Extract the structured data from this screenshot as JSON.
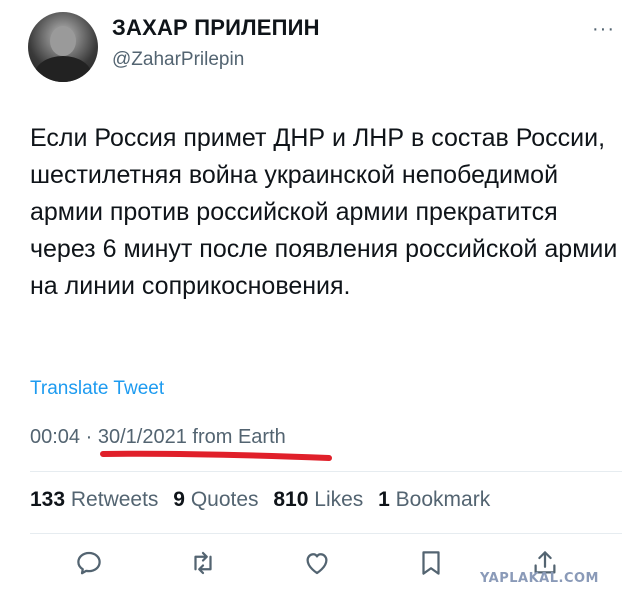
{
  "author": {
    "name": "ЗАХАР ПРИЛЕПИН",
    "handle": "@ZaharPrilepin"
  },
  "tweet": {
    "text": "Если Россия примет ДНР и ЛНР в состав России, шестилетняя война украинской непобедимой армии против российской армии прекратится через 6 минут после появления российской армии на линии соприкосновения.",
    "translate_label": "Translate Tweet",
    "time": "00:04",
    "separator": "·",
    "date_source": "30/1/2021 from Earth"
  },
  "stats": {
    "retweets_count": "133",
    "retweets_label": "Retweets",
    "quotes_count": "9",
    "quotes_label": "Quotes",
    "likes_count": "810",
    "likes_label": "Likes",
    "bookmarks_count": "1",
    "bookmarks_label": "Bookmark"
  },
  "menu_glyph": "···",
  "watermark": "YAPLAKAL.COM",
  "colors": {
    "link": "#1d9bf0",
    "secondary": "#536471",
    "underline": "#e0202a"
  },
  "icons": [
    "reply-icon",
    "retweet-icon",
    "like-icon",
    "bookmark-icon",
    "share-icon"
  ]
}
